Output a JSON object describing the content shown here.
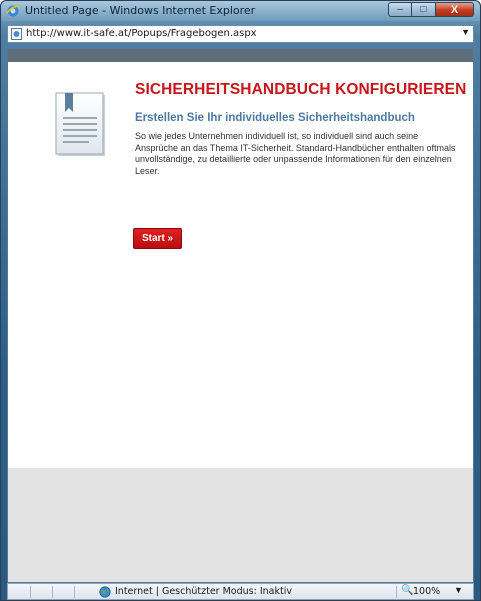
{
  "window": {
    "title": "Untitled Page - Windows Internet Explorer",
    "minimize_glyph": "–",
    "maximize_glyph": "□",
    "close_glyph": "X"
  },
  "address": {
    "url": "http://www.it-safe.at/Popups/Fragebogen.aspx",
    "dropdown_glyph": "▼"
  },
  "content": {
    "heading": "SICHERHEITSHANDBUCH KONFIGURIEREN",
    "subheading": "Erstellen Sie Ihr individuelles Sicherheitshandbuch",
    "body": "So wie jedes Unternehmen individuell ist, so individuell sind auch seine Ansprüche an das Thema IT-Sicherheit. Standard-Handbücher enthalten oftmals unvollständige, zu detaillierte oder unpassende Informationen für den einzelnen Leser.",
    "start_label": "Start »"
  },
  "status": {
    "zone_text": "Internet | Geschützter Modus: Inaktiv",
    "zoom_glyph": "🔍",
    "zoom": "100%",
    "zoom_arrow": "▼"
  },
  "colors": {
    "heading": "#c8161a",
    "subheading": "#4e7aa1",
    "button": "#c8161a",
    "frame_bar": "#5f6d7a"
  },
  "icons": [
    "ie-logo-icon",
    "page-icon",
    "document-icon",
    "globe-icon",
    "zoom-icon"
  ]
}
